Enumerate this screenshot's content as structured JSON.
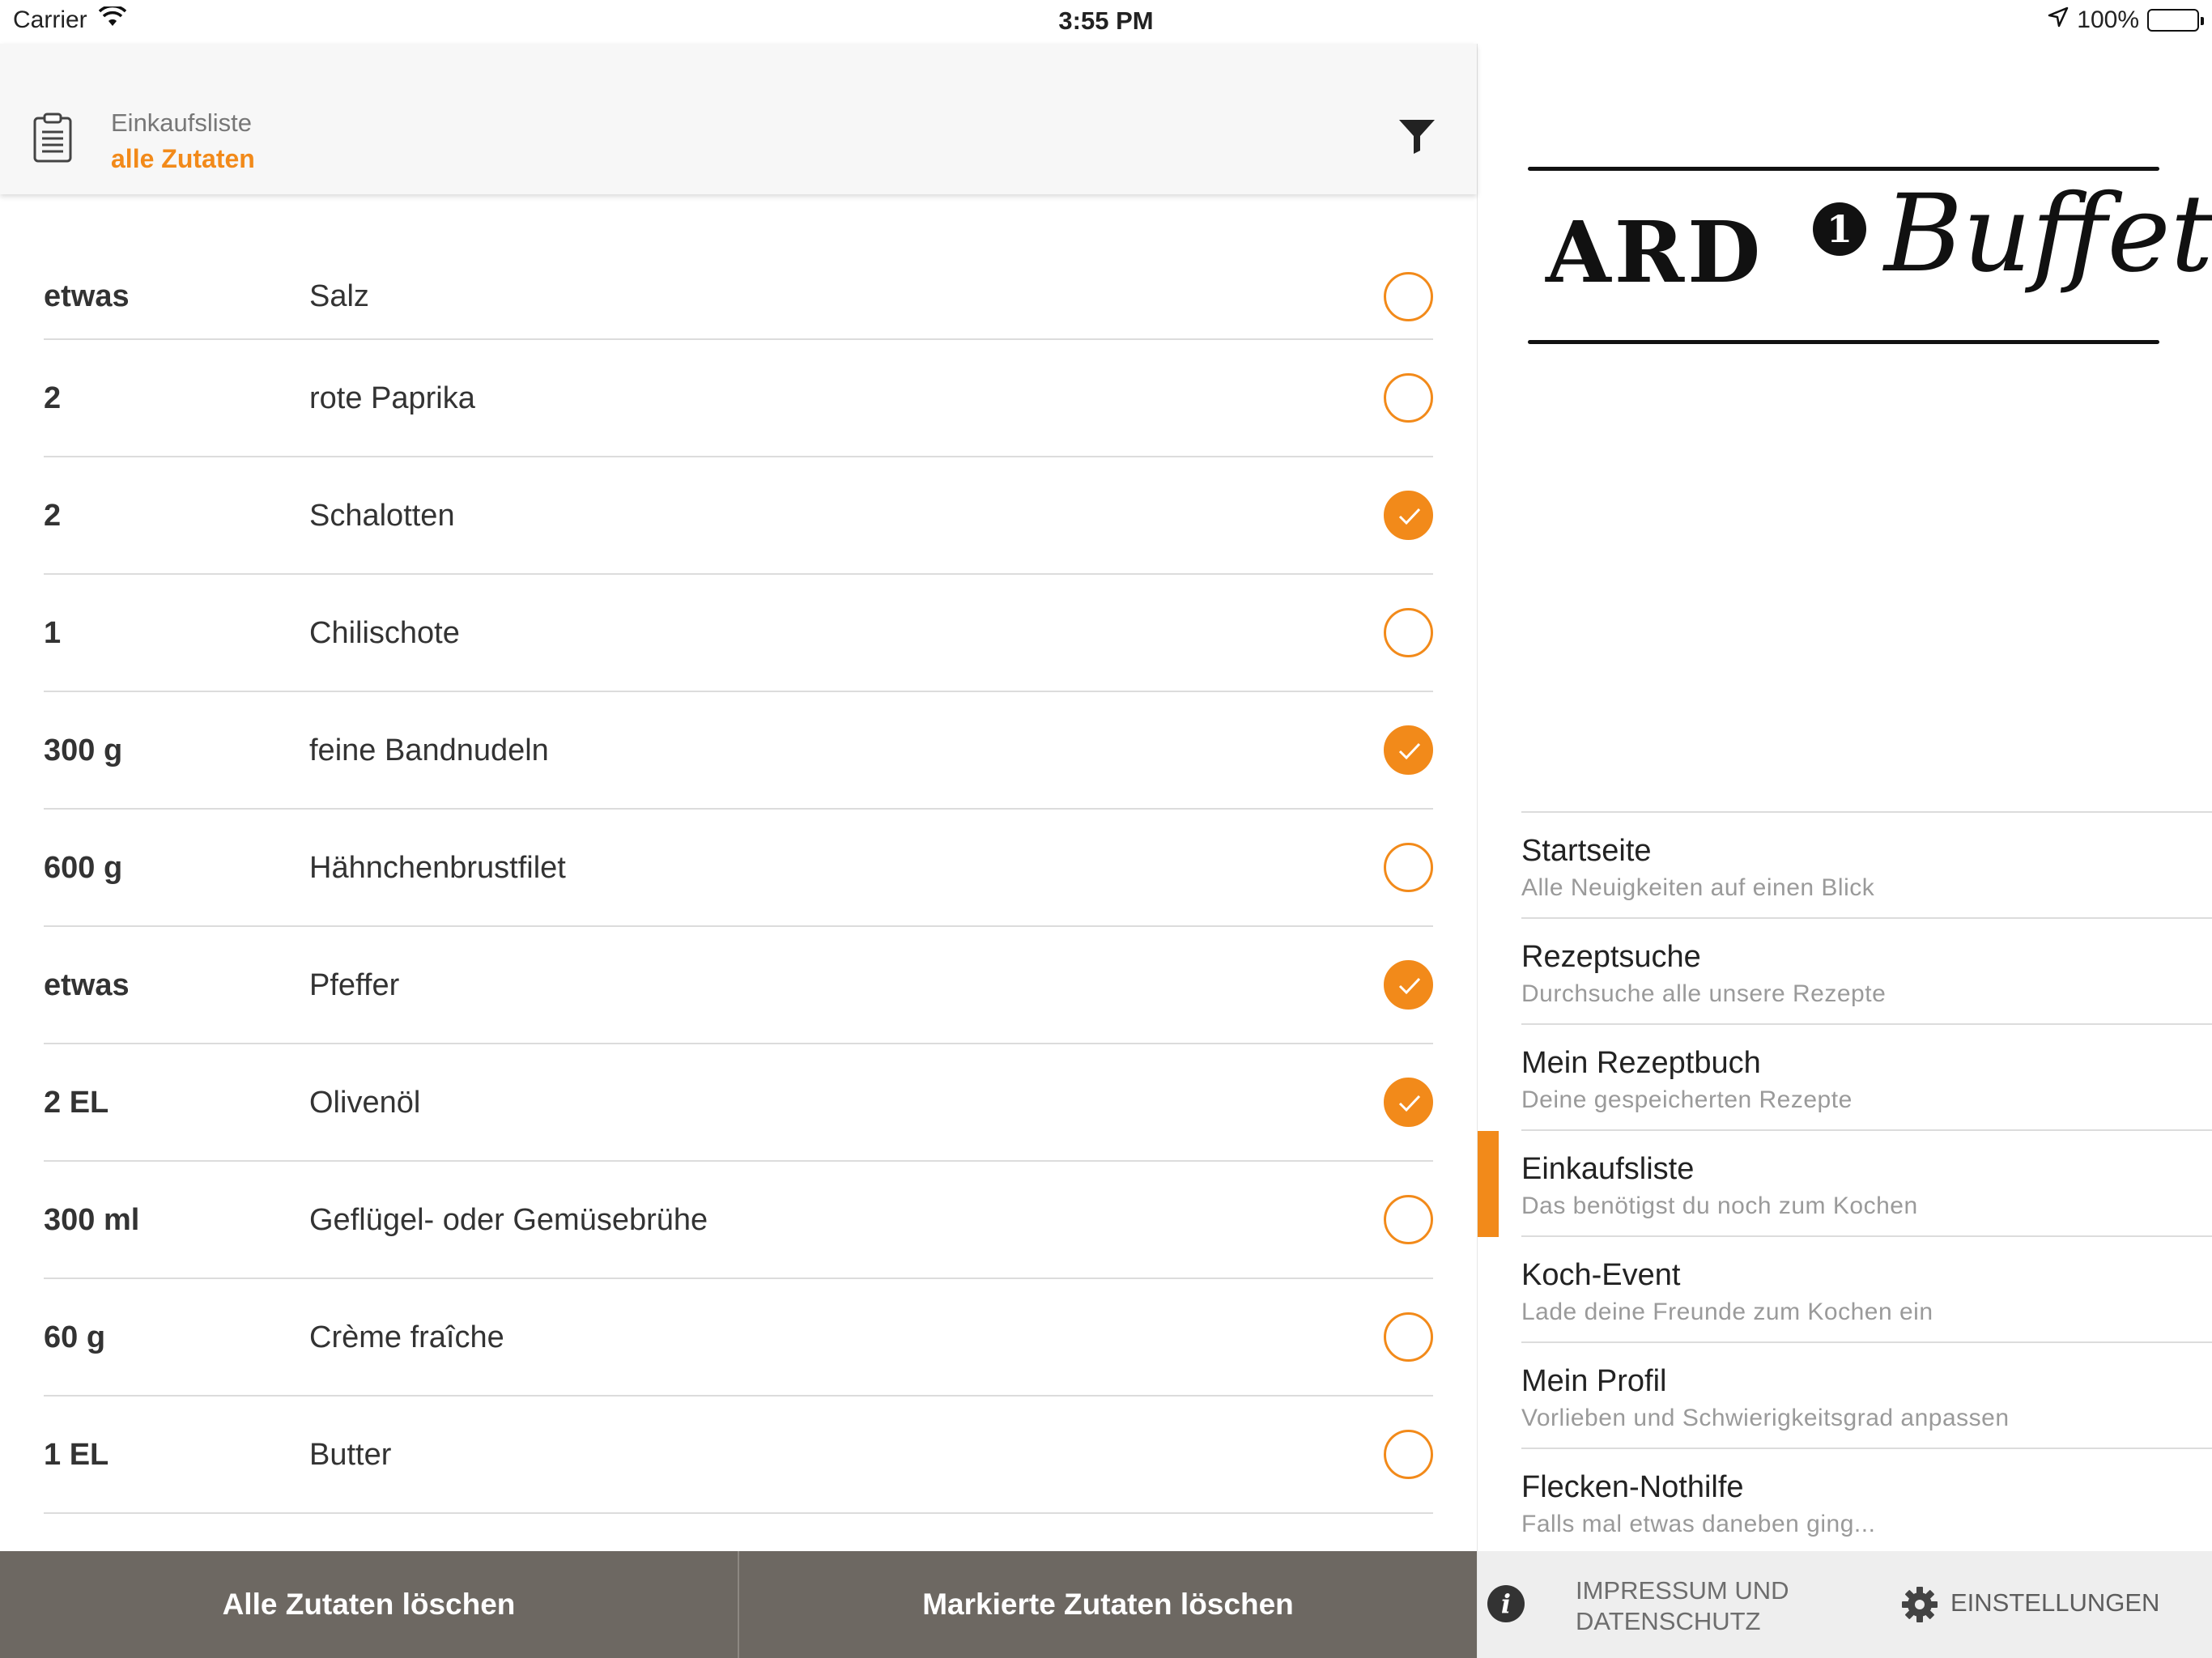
{
  "status_bar": {
    "carrier": "Carrier",
    "time": "3:55 PM",
    "battery": "100%"
  },
  "header": {
    "title": "Einkaufsliste",
    "subtitle": "alle Zutaten"
  },
  "items": [
    {
      "qty": "etwas",
      "name": "Salz",
      "checked": false
    },
    {
      "qty": "2",
      "name": "rote Paprika",
      "checked": false
    },
    {
      "qty": "2",
      "name": "Schalotten",
      "checked": true
    },
    {
      "qty": "1",
      "name": "Chilischote",
      "checked": false
    },
    {
      "qty": "300 g",
      "name": "feine Bandnudeln",
      "checked": true
    },
    {
      "qty": "600 g",
      "name": "Hähnchenbrustfilet",
      "checked": false
    },
    {
      "qty": "etwas",
      "name": "Pfeffer",
      "checked": true
    },
    {
      "qty": "2 EL",
      "name": "Olivenöl",
      "checked": true
    },
    {
      "qty": "300 ml",
      "name": "Geflügel- oder Gemüsebrühe",
      "checked": false
    },
    {
      "qty": "60 g",
      "name": "Crème fraîche",
      "checked": false
    },
    {
      "qty": "1 EL",
      "name": "Butter",
      "checked": false
    }
  ],
  "bottom_bar": {
    "clear_all": "Alle Zutaten löschen",
    "clear_marked": "Markierte Zutaten löschen"
  },
  "logo": {
    "ard": "ARD",
    "one": "1",
    "buffet": "Buffet"
  },
  "menu": [
    {
      "title": "Startseite",
      "subtitle": "Alle Neuigkeiten auf einen Blick",
      "active": false
    },
    {
      "title": "Rezeptsuche",
      "subtitle": "Durchsuche alle unsere Rezepte",
      "active": false
    },
    {
      "title": "Mein Rezeptbuch",
      "subtitle": "Deine gespeicherten Rezepte",
      "active": false
    },
    {
      "title": "Einkaufsliste",
      "subtitle": "Das benötigst du noch zum Kochen",
      "active": true
    },
    {
      "title": "Koch-Event",
      "subtitle": "Lade deine Freunde zum Kochen ein",
      "active": false
    },
    {
      "title": "Mein Profil",
      "subtitle": "Vorlieben und Schwierigkeitsgrad anpassen",
      "active": false
    },
    {
      "title": "Flecken-Nothilfe",
      "subtitle": "Falls mal etwas daneben ging...",
      "active": false
    }
  ],
  "footer": {
    "impressum": "IMPRESSUM UND DATENSCHUTZ",
    "settings": "EINSTELLUNGEN"
  },
  "colors": {
    "accent": "#f28a1a",
    "bottom_bar": "#6d6862"
  }
}
